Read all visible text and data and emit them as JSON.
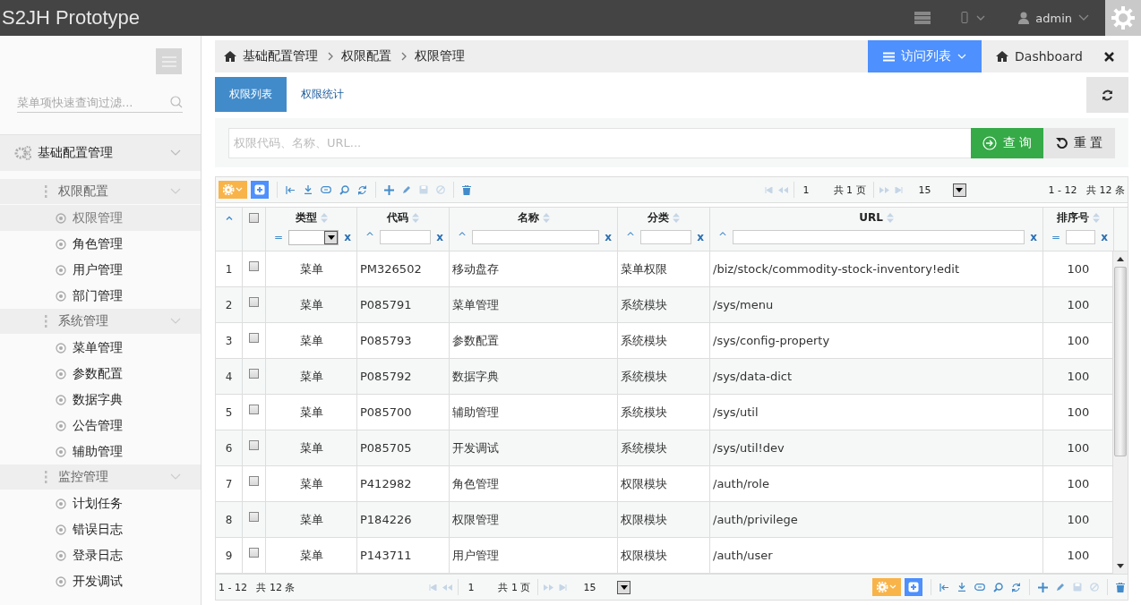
{
  "header": {
    "title": "S2JH Prototype",
    "user": "admin"
  },
  "sidebar": {
    "search_placeholder": "菜单项快速查询过滤...",
    "top_group": {
      "label": "基础配置管理",
      "expanded": true
    },
    "sections": [
      {
        "label": "权限配置",
        "expanded": true,
        "items": [
          {
            "label": "权限管理",
            "selected": true
          },
          {
            "label": "角色管理",
            "selected": false
          },
          {
            "label": "用户管理",
            "selected": false
          },
          {
            "label": "部门管理",
            "selected": false
          }
        ]
      },
      {
        "label": "系统管理",
        "expanded": true,
        "items": [
          {
            "label": "菜单管理",
            "selected": false
          },
          {
            "label": "参数配置",
            "selected": false
          },
          {
            "label": "数据字典",
            "selected": false
          },
          {
            "label": "公告管理",
            "selected": false
          },
          {
            "label": "辅助管理",
            "selected": false
          }
        ]
      },
      {
        "label": "监控管理",
        "expanded": true,
        "items": [
          {
            "label": "计划任务",
            "selected": false
          },
          {
            "label": "错误日志",
            "selected": false
          },
          {
            "label": "登录日志",
            "selected": false
          },
          {
            "label": "开发调试",
            "selected": false
          }
        ]
      }
    ]
  },
  "breadcrumb": [
    "基础配置管理",
    "权限配置",
    "权限管理"
  ],
  "visit_list": "访问列表",
  "dashboard": "Dashboard",
  "tabs": [
    {
      "label": "权限列表",
      "selected": true
    },
    {
      "label": "权限统计",
      "selected": false
    }
  ],
  "search": {
    "placeholder": "权限代码、名称、URL...",
    "query_button": "查 询",
    "reset_button": "重 置"
  },
  "grid": {
    "pagers": [
      {
        "page": "1",
        "pages": "共 1 页",
        "page_size": "15",
        "record_info": "1 - 12   共 12 条"
      },
      {
        "page": "1",
        "pages": "共 1 页",
        "page_size": "15",
        "record_info": "1 - 12   共 12 条"
      }
    ],
    "select_all_checked": false,
    "columns": [
      {
        "label": "类型",
        "kind": "select",
        "operator": "=",
        "clear": "x"
      },
      {
        "label": "代码",
        "kind": "text",
        "operator": "^",
        "clear": "x"
      },
      {
        "label": "名称",
        "kind": "text",
        "operator": "^",
        "clear": "x"
      },
      {
        "label": "分类",
        "kind": "text",
        "operator": "^",
        "clear": "x"
      },
      {
        "label": "URL",
        "kind": "text",
        "operator": "^",
        "clear": "x"
      },
      {
        "label": "排序号",
        "kind": "text",
        "operator": "=",
        "clear": "x"
      }
    ],
    "rows": [
      {
        "num": "1",
        "checked": false,
        "cells": [
          "菜单",
          "PM326502",
          "移动盘存",
          "菜单权限",
          "/biz/stock/commodity-stock-inventory!edit",
          "100"
        ]
      },
      {
        "num": "2",
        "checked": false,
        "cells": [
          "菜单",
          "P085791",
          "菜单管理",
          "系统模块",
          "/sys/menu",
          "100"
        ]
      },
      {
        "num": "3",
        "checked": false,
        "cells": [
          "菜单",
          "P085793",
          "参数配置",
          "系统模块",
          "/sys/config-property",
          "100"
        ]
      },
      {
        "num": "4",
        "checked": false,
        "cells": [
          "菜单",
          "P085792",
          "数据字典",
          "系统模块",
          "/sys/data-dict",
          "100"
        ]
      },
      {
        "num": "5",
        "checked": false,
        "cells": [
          "菜单",
          "P085700",
          "辅助管理",
          "系统模块",
          "/sys/util",
          "100"
        ]
      },
      {
        "num": "6",
        "checked": false,
        "cells": [
          "菜单",
          "P085705",
          "开发调试",
          "系统模块",
          "/sys/util!dev",
          "100"
        ]
      },
      {
        "num": "7",
        "checked": false,
        "cells": [
          "菜单",
          "P412982",
          "角色管理",
          "权限模块",
          "/auth/role",
          "100"
        ]
      },
      {
        "num": "8",
        "checked": false,
        "cells": [
          "菜单",
          "P184226",
          "权限管理",
          "权限模块",
          "/auth/privilege",
          "100"
        ]
      },
      {
        "num": "9",
        "checked": false,
        "cells": [
          "菜单",
          "P143711",
          "用户管理",
          "权限模块",
          "/auth/user",
          "100"
        ]
      }
    ]
  }
}
